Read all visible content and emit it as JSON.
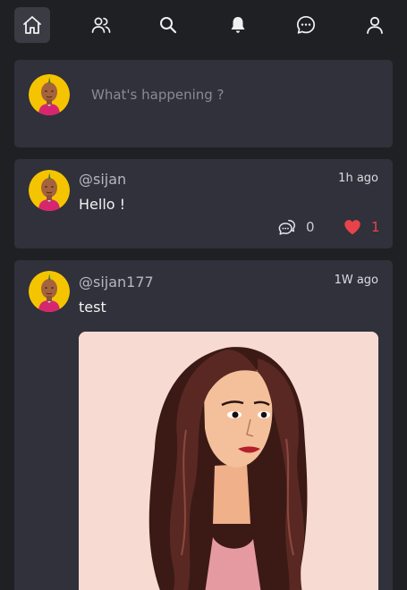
{
  "nav": {
    "items": [
      {
        "name": "home",
        "icon": "home-icon",
        "active": true
      },
      {
        "name": "friends",
        "icon": "users-icon",
        "active": false
      },
      {
        "name": "search",
        "icon": "search-icon",
        "active": false
      },
      {
        "name": "notifications",
        "icon": "bell-icon",
        "active": false
      },
      {
        "name": "messages",
        "icon": "chat-icon",
        "active": false
      },
      {
        "name": "profile",
        "icon": "user-icon",
        "active": false
      }
    ]
  },
  "composer": {
    "placeholder": "What's happening ?"
  },
  "posts": [
    {
      "username": "@sijan",
      "time": "1h ago",
      "content": "Hello !",
      "comments": "0",
      "likes": "1",
      "liked": true
    },
    {
      "username": "@sijan177",
      "time": "1W ago",
      "content": "test",
      "has_image": true
    }
  ],
  "colors": {
    "background": "#1f2023",
    "card": "#30313a",
    "like": "#e8434c",
    "avatar_bg": "#f5c400"
  }
}
